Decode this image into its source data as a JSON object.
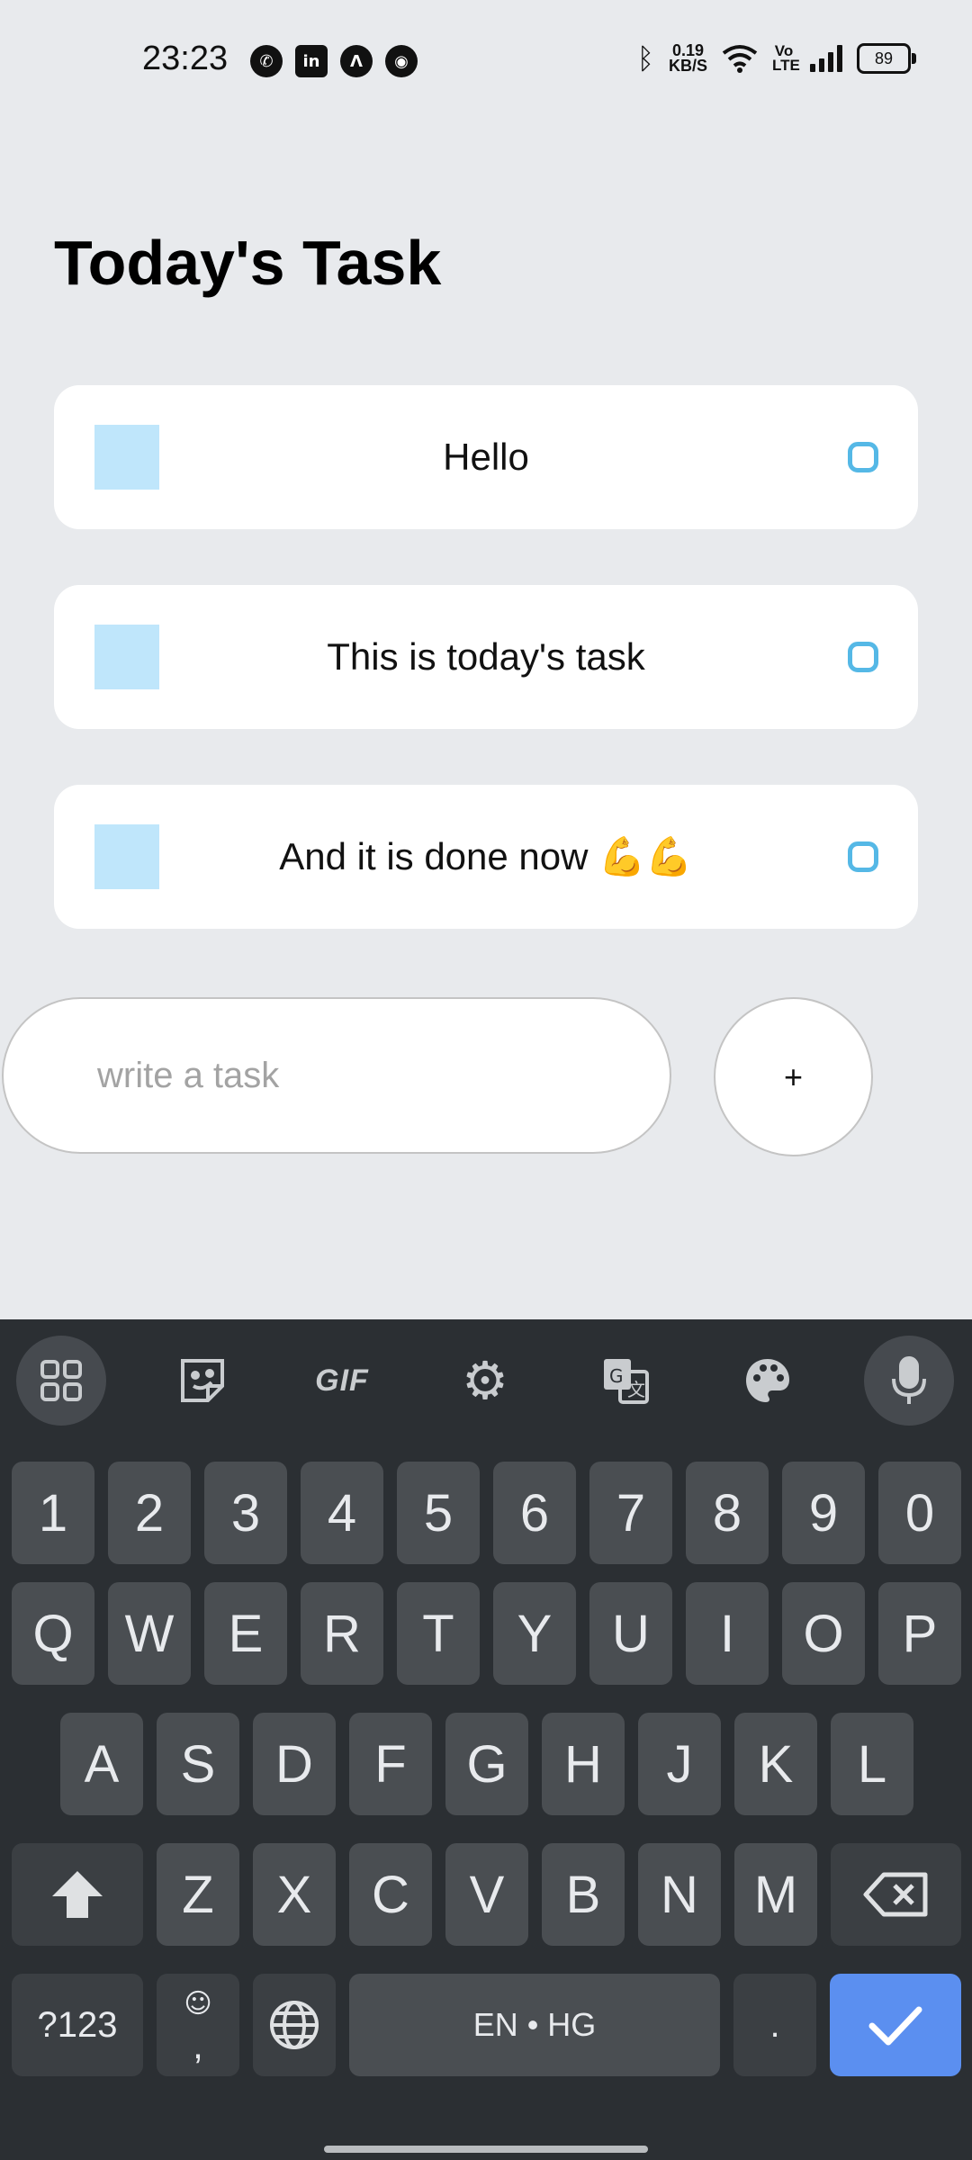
{
  "status_bar": {
    "time": "23:23",
    "notification_icons": [
      "whatsapp-icon",
      "linkedin-icon",
      "arc-icon",
      "chrome-icon"
    ],
    "net_speed_value": "0.19",
    "net_speed_unit": "KB/S",
    "volte": "Vo LTE",
    "battery": "89"
  },
  "page": {
    "title": "Today's Task"
  },
  "tasks": [
    {
      "text": "Hello"
    },
    {
      "text": "This is today's task"
    },
    {
      "text": "And it is done now 💪💪"
    }
  ],
  "composer": {
    "placeholder": "write a task",
    "value": "",
    "add_label": "+"
  },
  "keyboard": {
    "toolbar": [
      "grid-icon",
      "sticker-icon",
      "gif",
      "settings-icon",
      "translate-icon",
      "palette-icon",
      "mic-icon"
    ],
    "gif_label": "GIF",
    "number_row": [
      "1",
      "2",
      "3",
      "4",
      "5",
      "6",
      "7",
      "8",
      "9",
      "0"
    ],
    "row1": [
      "Q",
      "W",
      "E",
      "R",
      "T",
      "Y",
      "U",
      "I",
      "O",
      "P"
    ],
    "row2": [
      "A",
      "S",
      "D",
      "F",
      "G",
      "H",
      "J",
      "K",
      "L"
    ],
    "row3": [
      "Z",
      "X",
      "C",
      "V",
      "B",
      "N",
      "M"
    ],
    "symbols_label": "?123",
    "comma_label": ",",
    "space_label": "EN • HG",
    "period_label": ".",
    "accent_color": "#5b8ff0"
  },
  "colors": {
    "background": "#e8eaed",
    "task_square": "#bfe6fb",
    "task_circle": "#55b8e6",
    "keyboard_bg": "#2b2f33"
  }
}
